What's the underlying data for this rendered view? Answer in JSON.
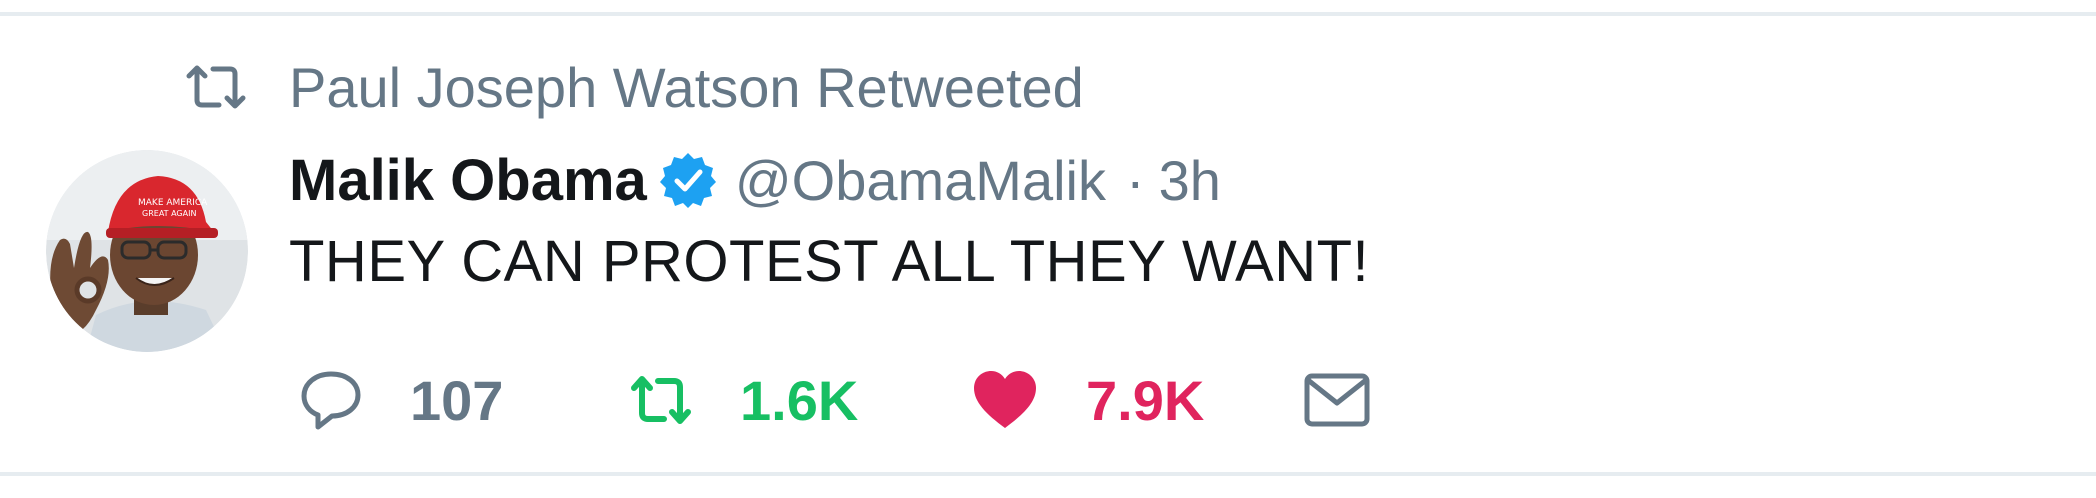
{
  "retweet_context": {
    "text": "Paul Joseph Watson Retweeted",
    "icon": "retweet-icon"
  },
  "author": {
    "display_name": "Malik Obama",
    "verified": true,
    "handle": "@ObamaMalik",
    "separator": "·",
    "time": "3h"
  },
  "tweet": {
    "text": "THEY CAN PROTEST ALL THEY WANT!"
  },
  "actions": {
    "reply": {
      "icon": "reply-icon",
      "count": "107"
    },
    "retweet": {
      "icon": "retweet-icon",
      "count": "1.6K"
    },
    "like": {
      "icon": "heart-icon",
      "count": "7.9K"
    },
    "dm": {
      "icon": "envelope-icon"
    }
  },
  "colors": {
    "secondary_text": "#657786",
    "primary_text": "#14171a",
    "retweet_green": "#17bf63",
    "like_red": "#e0245e",
    "verified_blue": "#1da1f2",
    "divider": "#e6ecf0"
  }
}
